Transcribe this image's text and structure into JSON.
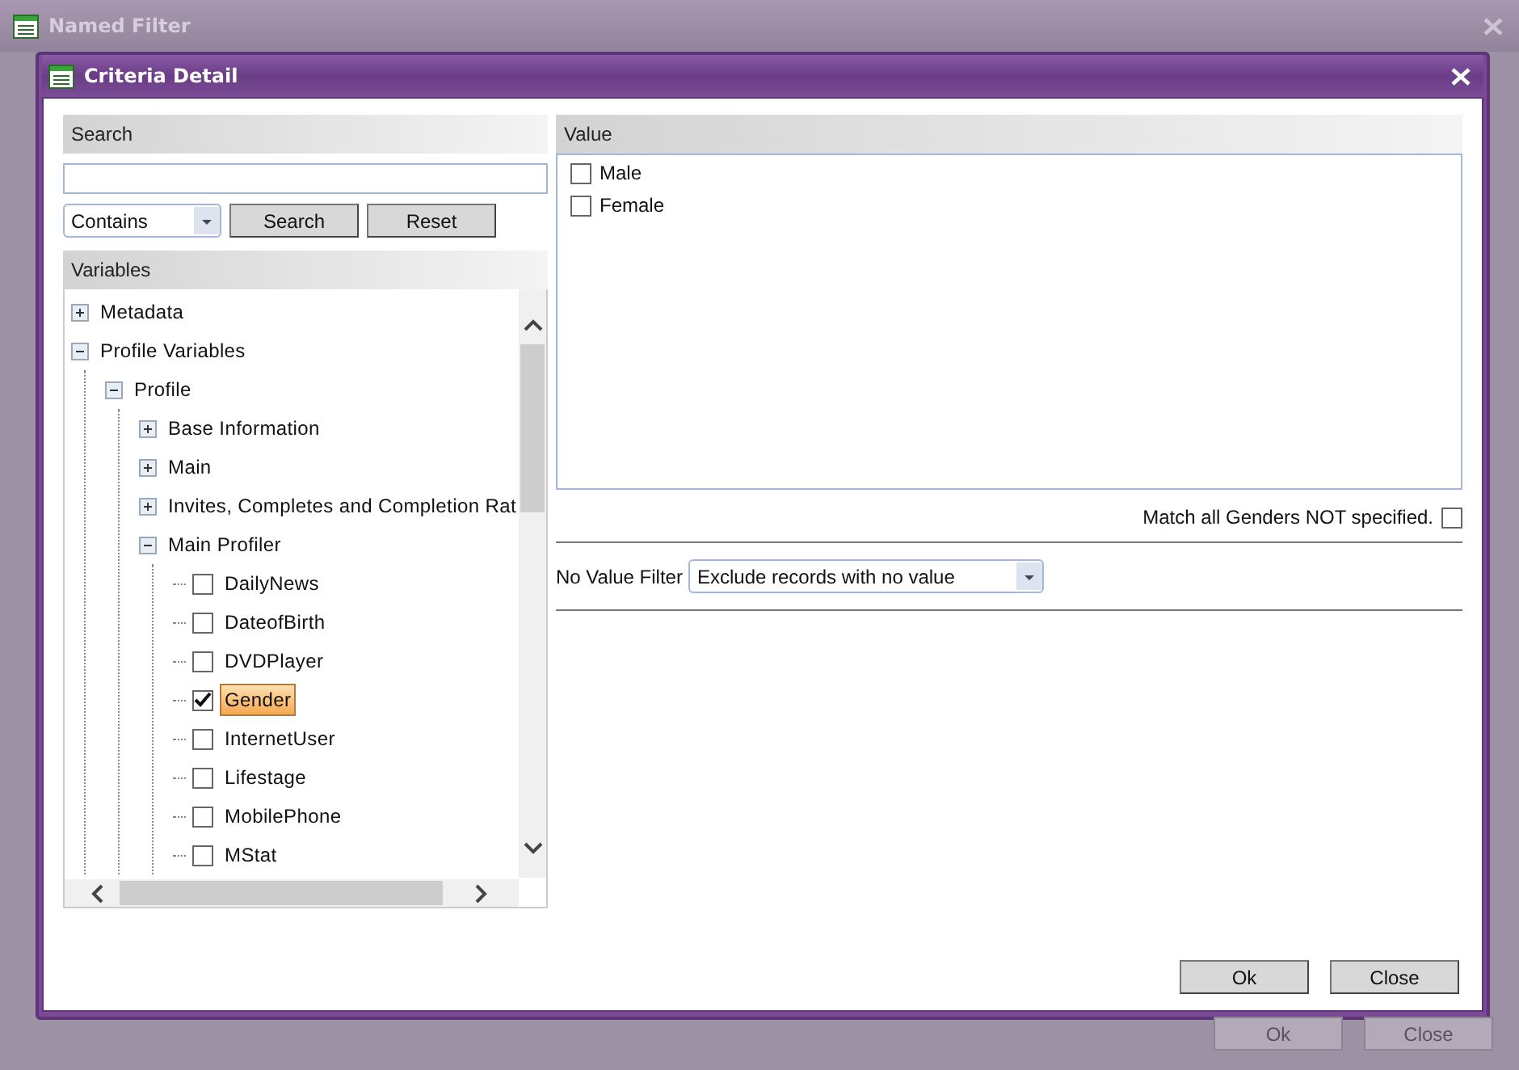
{
  "background_window": {
    "title": "Named Filter",
    "buttons": [
      "Ok",
      "Close"
    ]
  },
  "dialog": {
    "title": "Criteria Detail",
    "search": {
      "header": "Search",
      "mode": "Contains",
      "buttons": [
        "Search",
        "Reset"
      ]
    },
    "variables": {
      "header": "Variables",
      "tree": [
        {
          "label": "Metadata",
          "kind": "group",
          "expanded": false
        },
        {
          "label": "Profile Variables",
          "kind": "group",
          "expanded": true,
          "children": [
            {
              "label": "Profile",
              "kind": "group",
              "expanded": true,
              "children": [
                {
                  "label": "Base Information",
                  "kind": "group",
                  "expanded": false
                },
                {
                  "label": "Main",
                  "kind": "group",
                  "expanded": false
                },
                {
                  "label": "Invites, Completes and Completion Rat",
                  "kind": "group",
                  "expanded": false
                },
                {
                  "label": "Main Profiler",
                  "kind": "group",
                  "expanded": true,
                  "children": [
                    {
                      "label": "DailyNews",
                      "kind": "item",
                      "checked": false,
                      "selected": false
                    },
                    {
                      "label": "DateofBirth",
                      "kind": "item",
                      "checked": false,
                      "selected": false
                    },
                    {
                      "label": "DVDPlayer",
                      "kind": "item",
                      "checked": false,
                      "selected": false
                    },
                    {
                      "label": "Gender",
                      "kind": "item",
                      "checked": true,
                      "selected": true
                    },
                    {
                      "label": "InternetUser",
                      "kind": "item",
                      "checked": false,
                      "selected": false
                    },
                    {
                      "label": "Lifestage",
                      "kind": "item",
                      "checked": false,
                      "selected": false
                    },
                    {
                      "label": "MobilePhone",
                      "kind": "item",
                      "checked": false,
                      "selected": false
                    },
                    {
                      "label": "MStat",
                      "kind": "item",
                      "checked": false,
                      "selected": false
                    }
                  ]
                }
              ]
            }
          ]
        }
      ]
    },
    "value_panel": {
      "header": "Value",
      "options": [
        {
          "label": "Male",
          "checked": false
        },
        {
          "label": "Female",
          "checked": false
        }
      ]
    },
    "match_unspecified": {
      "label": "Match all Genders NOT specified.",
      "checked": false
    },
    "no_value_filter": {
      "label": "No Value Filter",
      "value": "Exclude records with no value"
    },
    "buttons": [
      "Ok",
      "Close"
    ]
  }
}
